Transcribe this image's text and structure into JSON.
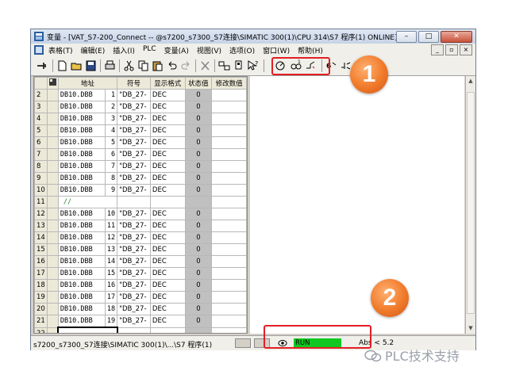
{
  "window": {
    "title": "变量 - [VAT_S7-200_Connect -- @s7200_s7300_S7连接\\SIMATIC 300(1)\\CPU 314\\S7 程序(1)  ONLINE]",
    "buttons": {
      "minimize": "–",
      "maximize": "□",
      "close": "✕"
    }
  },
  "menubar": {
    "items": [
      "表格(T)",
      "编辑(E)",
      "插入(I)",
      "PLC",
      "变量(A)",
      "视图(V)",
      "选项(O)",
      "窗口(W)",
      "帮助(H)"
    ],
    "mdi_buttons": [
      "_",
      "▫",
      "×"
    ]
  },
  "toolbar": {
    "icons": [
      "pin-icon",
      "new-icon",
      "open-icon",
      "save-icon",
      "print-icon",
      "cut-icon",
      "copy-icon",
      "paste-icon",
      "undo-icon",
      "redo-icon",
      "delete-icon",
      "monitor-config-icon",
      "trigger-icon",
      "help-pointer-icon",
      "monitor-variable-icon",
      "modify-variable-icon",
      "update-monitor-icon",
      "activate-modify-icon",
      "force-icon"
    ]
  },
  "table": {
    "headers": [
      "地址",
      "符号",
      "显示格式",
      "状态值",
      "修改数值"
    ],
    "rows": [
      {
        "n": "2",
        "addr": "DB10.DBB",
        "idx": "1",
        "sym": "\"DB_27-",
        "fmt": "DEC",
        "val": "0"
      },
      {
        "n": "3",
        "addr": "DB10.DBB",
        "idx": "2",
        "sym": "\"DB_27-",
        "fmt": "DEC",
        "val": "0"
      },
      {
        "n": "4",
        "addr": "DB10.DBB",
        "idx": "3",
        "sym": "\"DB_27-",
        "fmt": "DEC",
        "val": "0"
      },
      {
        "n": "5",
        "addr": "DB10.DBB",
        "idx": "4",
        "sym": "\"DB_27-",
        "fmt": "DEC",
        "val": "0"
      },
      {
        "n": "6",
        "addr": "DB10.DBB",
        "idx": "5",
        "sym": "\"DB_27-",
        "fmt": "DEC",
        "val": "0"
      },
      {
        "n": "7",
        "addr": "DB10.DBB",
        "idx": "6",
        "sym": "\"DB_27-",
        "fmt": "DEC",
        "val": "0"
      },
      {
        "n": "8",
        "addr": "DB10.DBB",
        "idx": "7",
        "sym": "\"DB_27-",
        "fmt": "DEC",
        "val": "0"
      },
      {
        "n": "9",
        "addr": "DB10.DBB",
        "idx": "8",
        "sym": "\"DB_27-",
        "fmt": "DEC",
        "val": "0"
      },
      {
        "n": "10",
        "addr": "DB10.DBB",
        "idx": "9",
        "sym": "\"DB_27-",
        "fmt": "DEC",
        "val": "0"
      },
      {
        "n": "11",
        "addr": "//",
        "idx": "",
        "sym": "",
        "fmt": "",
        "val": "",
        "comment": true
      },
      {
        "n": "12",
        "addr": "DB10.DBB",
        "idx": "10",
        "sym": "\"DB_27-",
        "fmt": "DEC",
        "val": "0"
      },
      {
        "n": "13",
        "addr": "DB10.DBB",
        "idx": "11",
        "sym": "\"DB_27-",
        "fmt": "DEC",
        "val": "0"
      },
      {
        "n": "14",
        "addr": "DB10.DBB",
        "idx": "12",
        "sym": "\"DB_27-",
        "fmt": "DEC",
        "val": "0"
      },
      {
        "n": "15",
        "addr": "DB10.DBB",
        "idx": "13",
        "sym": "\"DB_27-",
        "fmt": "DEC",
        "val": "0"
      },
      {
        "n": "16",
        "addr": "DB10.DBB",
        "idx": "14",
        "sym": "\"DB_27-",
        "fmt": "DEC",
        "val": "0"
      },
      {
        "n": "17",
        "addr": "DB10.DBB",
        "idx": "15",
        "sym": "\"DB_27-",
        "fmt": "DEC",
        "val": "0"
      },
      {
        "n": "18",
        "addr": "DB10.DBB",
        "idx": "16",
        "sym": "\"DB_27-",
        "fmt": "DEC",
        "val": "0"
      },
      {
        "n": "19",
        "addr": "DB10.DBB",
        "idx": "17",
        "sym": "\"DB_27-",
        "fmt": "DEC",
        "val": "0"
      },
      {
        "n": "20",
        "addr": "DB10.DBB",
        "idx": "18",
        "sym": "\"DB_27-",
        "fmt": "DEC",
        "val": "0"
      },
      {
        "n": "21",
        "addr": "DB10.DBB",
        "idx": "19",
        "sym": "\"DB_27-",
        "fmt": "DEC",
        "val": "0"
      },
      {
        "n": "22",
        "addr": "",
        "idx": "",
        "sym": "",
        "fmt": "",
        "val": "",
        "selected": true
      }
    ]
  },
  "statusbar": {
    "path": "s7200_s7300_S7连接\\SIMATIC 300(1)\\...\\S7 程序(1)",
    "mode": "RUN",
    "abs": "Abs < 5.2"
  },
  "callouts": [
    "1",
    "2"
  ],
  "watermark": "PLC技术支持",
  "colors": {
    "highlight": "#e31e24",
    "run": "#11c822",
    "callout": "#f07a2a"
  }
}
